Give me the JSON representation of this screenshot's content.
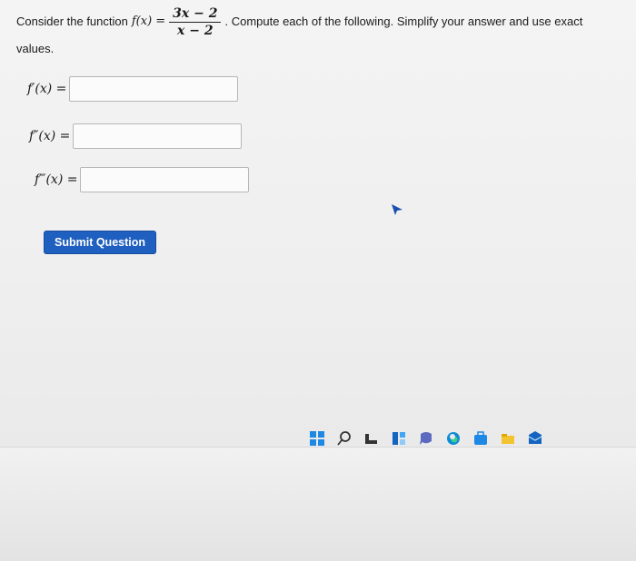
{
  "question": {
    "prefix": "Consider the function ",
    "func": "f(x) =",
    "numerator": "3x − 2",
    "denominator": "x − 2",
    "suffix": ". Compute each of the following. Simplify your answer and use exact",
    "line2": "values."
  },
  "answers": [
    {
      "label": "f′(x) =",
      "value": ""
    },
    {
      "label": "f″(x) =",
      "value": ""
    },
    {
      "label": "f‴(x) =",
      "value": ""
    }
  ],
  "submit_label": "Submit Question",
  "taskbar": {
    "icons": [
      "windows-start-icon",
      "search-icon",
      "task-view-icon",
      "widgets-icon",
      "chat-icon",
      "edge-icon",
      "store-icon",
      "file-explorer-icon",
      "mail-icon"
    ]
  },
  "colors": {
    "submit_bg": "#1f5fbf",
    "submit_text": "#ffffff"
  }
}
